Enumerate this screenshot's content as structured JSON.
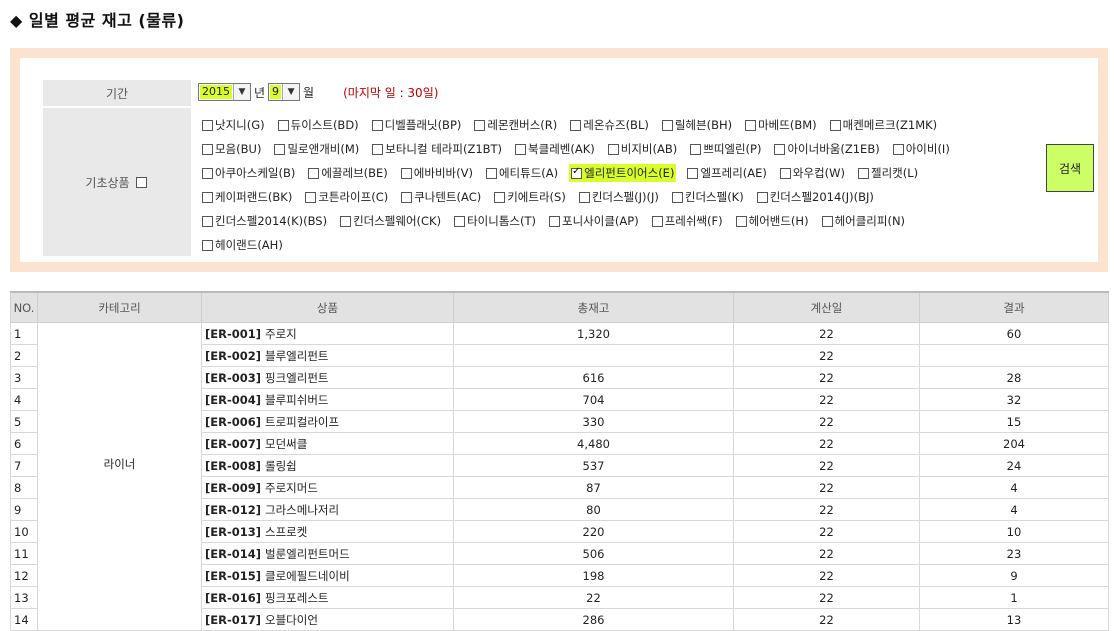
{
  "page": {
    "title": "◆ 일별 평균 재고 (물류)"
  },
  "filter": {
    "period_label": "기간",
    "year": "2015",
    "year_suffix": "년",
    "month": "9",
    "month_suffix": "월",
    "last_day_note": "(마지막 일 : 30일)",
    "basic_label": "기초상품",
    "search_label": "검색",
    "products": [
      [
        "낫지니(G)",
        "듀이스트(BD)",
        "디벨플래닛(BP)",
        "레몬캔버스(R)",
        "레온슈즈(BL)",
        "릴헤븐(BH)",
        "마베뜨(BM)",
        "매켄메르크(Z1MK)"
      ],
      [
        "모음(BU)",
        "밀로앤개비(M)",
        "보타니컬 테라피(Z1BT)",
        "북클레벤(AK)",
        "비지비(AB)",
        "쁘띠엘린(P)",
        "아이너바움(Z1EB)",
        "아이비(I)"
      ],
      [
        "아쿠아스케일(B)",
        "에끌레브(BE)",
        "에바비바(V)",
        "에티튜드(A)",
        "엘리펀트이어스(E)",
        "엘프레리(AE)",
        "와우컵(W)",
        "젤리캣(L)"
      ],
      [
        "케이퍼랜드(BK)",
        "코튼라이프(C)",
        "쿠나텐트(AC)",
        "키에트라(S)",
        "킨더스펠(J)(J)",
        "킨더스펠(K)",
        "킨더스펠2014(J)(BJ)"
      ],
      [
        "킨더스펠2014(K)(BS)",
        "킨더스펠웨어(CK)",
        "타이니톰스(T)",
        "포니사이클(AP)",
        "프레쉬쌕(F)",
        "헤어밴드(H)",
        "헤어클리피(N)"
      ],
      [
        "헤이랜드(AH)"
      ]
    ],
    "checked_product": "엘리펀트이어스(E)"
  },
  "table": {
    "headers": [
      "NO.",
      "카테고리",
      "상품",
      "총재고",
      "계산일",
      "결과"
    ],
    "category": "라이너",
    "rows": [
      {
        "no": "1",
        "code": "[ER-001]",
        "name": "주로지",
        "total": "1,320",
        "days": "22",
        "result": "60"
      },
      {
        "no": "2",
        "code": "[ER-002]",
        "name": "블루엘리펀트",
        "total": "",
        "days": "22",
        "result": ""
      },
      {
        "no": "3",
        "code": "[ER-003]",
        "name": "핑크엘리펀트",
        "total": "616",
        "days": "22",
        "result": "28"
      },
      {
        "no": "4",
        "code": "[ER-004]",
        "name": "블루피쉬버드",
        "total": "704",
        "days": "22",
        "result": "32"
      },
      {
        "no": "5",
        "code": "[ER-006]",
        "name": "트로피컬라이프",
        "total": "330",
        "days": "22",
        "result": "15"
      },
      {
        "no": "6",
        "code": "[ER-007]",
        "name": "모던써클",
        "total": "4,480",
        "days": "22",
        "result": "204"
      },
      {
        "no": "7",
        "code": "[ER-008]",
        "name": "롤링쉽",
        "total": "537",
        "days": "22",
        "result": "24"
      },
      {
        "no": "8",
        "code": "[ER-009]",
        "name": "주로지머드",
        "total": "87",
        "days": "22",
        "result": "4"
      },
      {
        "no": "9",
        "code": "[ER-012]",
        "name": "그라스메나저리",
        "total": "80",
        "days": "22",
        "result": "4"
      },
      {
        "no": "10",
        "code": "[ER-013]",
        "name": "스프로켓",
        "total": "220",
        "days": "22",
        "result": "10"
      },
      {
        "no": "11",
        "code": "[ER-014]",
        "name": "벌룬엘리펀트머드",
        "total": "506",
        "days": "22",
        "result": "23"
      },
      {
        "no": "12",
        "code": "[ER-015]",
        "name": "클로에필드네이비",
        "total": "198",
        "days": "22",
        "result": "9"
      },
      {
        "no": "13",
        "code": "[ER-016]",
        "name": "핑크포레스트",
        "total": "22",
        "days": "22",
        "result": "1"
      },
      {
        "no": "14",
        "code": "[ER-017]",
        "name": "오블다이언",
        "total": "286",
        "days": "22",
        "result": "13"
      }
    ]
  },
  "colors": {
    "highlight": "#d8ff2a",
    "search_button": "#ccff66",
    "filter_border": "#fbe3cf",
    "note_red": "#c00000"
  }
}
